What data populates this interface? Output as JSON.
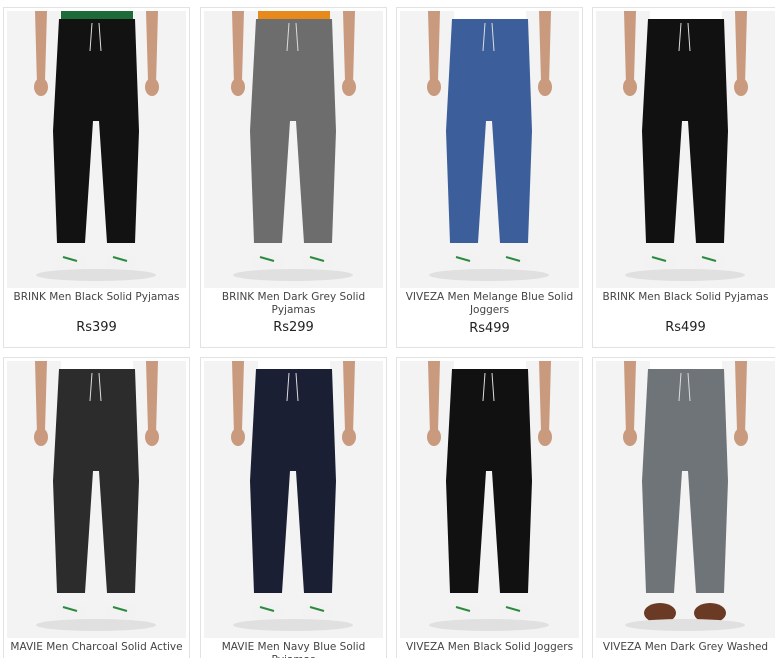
{
  "products": [
    {
      "title": "BRINK Men Black Solid Pyjamas",
      "price": "Rs399",
      "pants_color": "#121212",
      "shirt_color": "#1e6b3a",
      "shoe": "white-green"
    },
    {
      "title": "BRINK Men Dark Grey Solid Pyjamas",
      "price": "Rs299",
      "pants_color": "#6d6d6d",
      "shirt_color": "#e8891c",
      "shoe": "white-green"
    },
    {
      "title": "VIVEZA Men Melange Blue Solid Joggers",
      "price": "Rs499",
      "pants_color": "#3c5f9c",
      "shirt_color": "#ffffff",
      "shoe": "white-green"
    },
    {
      "title": "BRINK Men Black Solid Pyjamas",
      "price": "Rs499",
      "pants_color": "#111111",
      "shirt_color": "#ffffff",
      "shoe": "white-green"
    },
    {
      "title": "MAVIE Men Charcoal Solid Active",
      "price": "",
      "pants_color": "#2b2c2b",
      "shirt_color": "#ffffff",
      "shoe": "white-green"
    },
    {
      "title": "MAVIE Men Navy Blue Solid Pyjamas",
      "price": "",
      "pants_color": "#1a1f33",
      "shirt_color": "#ffffff",
      "shoe": "white-green"
    },
    {
      "title": "VIVEZA Men Black Solid Joggers",
      "price": "",
      "pants_color": "#111111",
      "shirt_color": "#ffffff",
      "shoe": "white-green"
    },
    {
      "title": "VIVEZA Men Dark Grey Washed",
      "price": "",
      "pants_color": "#6f7479",
      "shirt_color": "#ffffff",
      "shoe": "brown"
    }
  ]
}
